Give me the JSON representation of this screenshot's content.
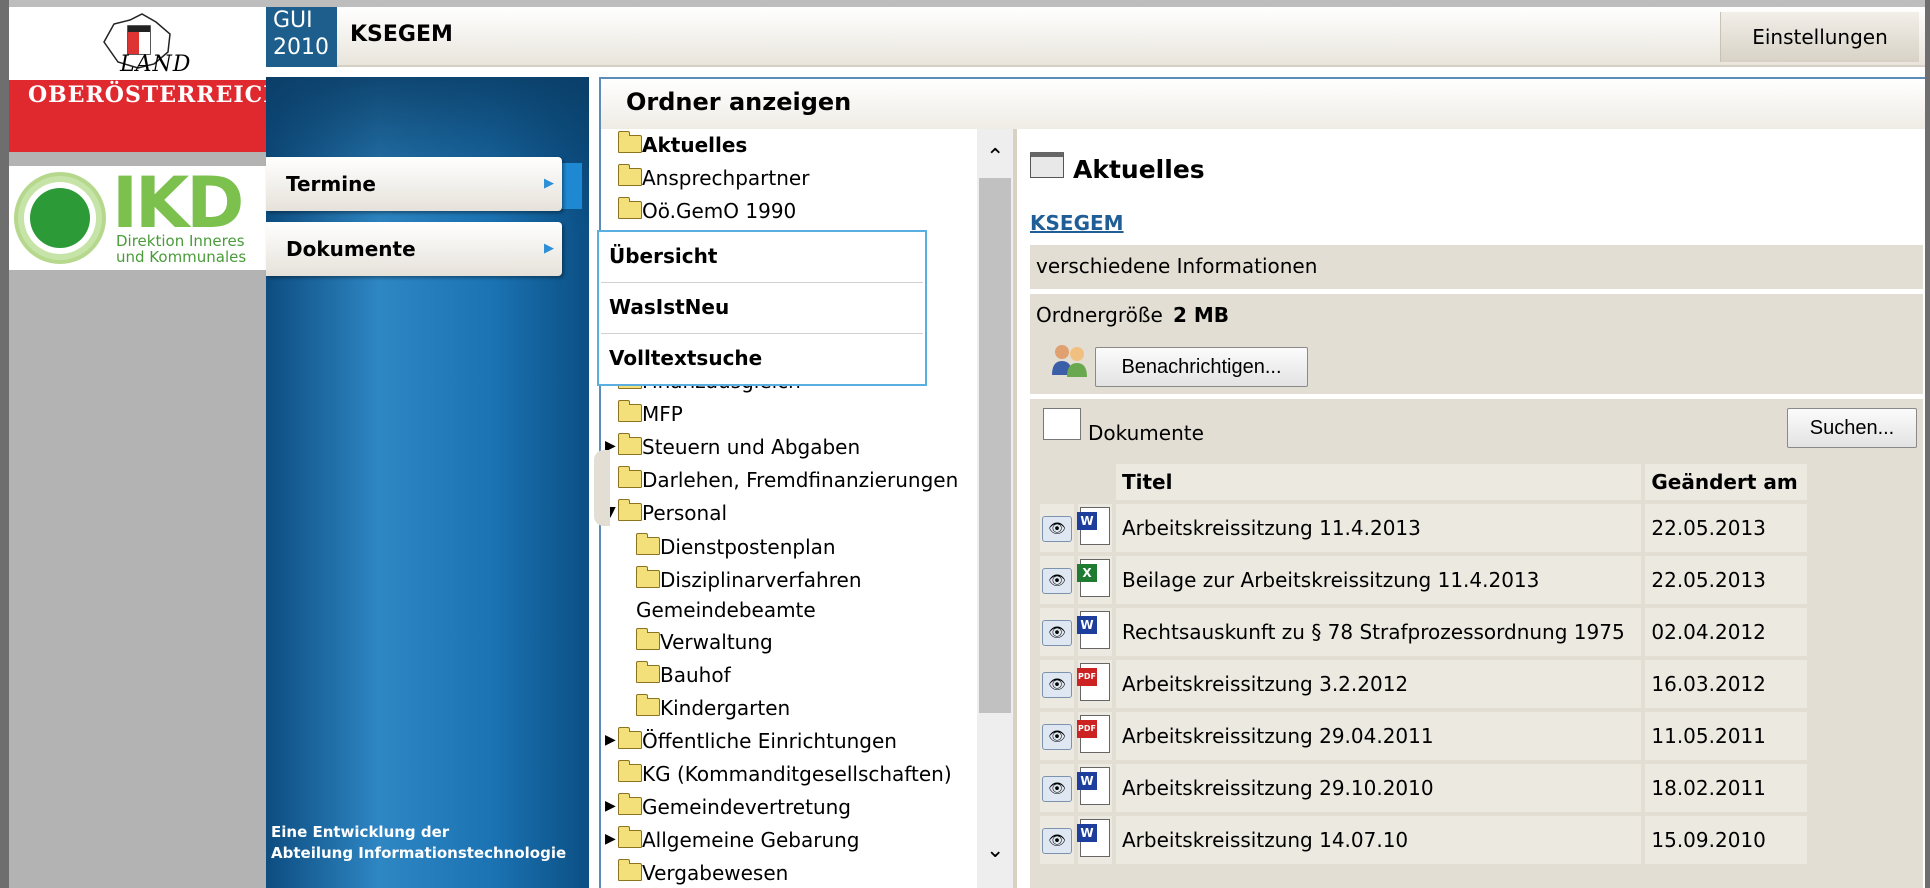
{
  "branding": {
    "land_label": "LAND",
    "state_label": "OBERÖSTERREICH",
    "ikd_label": "IKD",
    "ikd_subtitle_line1": "Direktion Inneres",
    "ikd_subtitle_line2": "und Kommunales",
    "gui_line1": "GUI",
    "gui_line2": "2010"
  },
  "header": {
    "app_title": "KSEGEM",
    "settings_label": "Einstellungen"
  },
  "nav": {
    "items": [
      {
        "label": "Termine"
      },
      {
        "label": "Dokumente"
      }
    ],
    "footer_line1": "Eine Entwicklung der",
    "footer_line2": "Abteilung Informationstechnologie"
  },
  "dropdown": {
    "items": [
      {
        "label": "Übersicht"
      },
      {
        "label": "WasIstNeu"
      },
      {
        "label": "Volltextsuche"
      }
    ]
  },
  "folders": {
    "title": "Ordner anzeigen",
    "items": [
      {
        "label": "Aktuelles",
        "bold": true
      },
      {
        "label": "Ansprechpartner"
      },
      {
        "label": "Oö.GemO 1990"
      },
      {
        "label": "Finanzausgleich"
      },
      {
        "label": "MFP"
      },
      {
        "label": "Steuern und Abgaben",
        "expandable": true
      },
      {
        "label": "Darlehen, Fremdfinanzierungen"
      },
      {
        "label": "Personal",
        "expandable": true
      },
      {
        "label": "Dienstpostenplan"
      },
      {
        "label": "Disziplinarverfahren"
      },
      {
        "label": "Gemeindebeamte"
      },
      {
        "label": "Verwaltung"
      },
      {
        "label": "Bauhof"
      },
      {
        "label": "Kindergarten"
      },
      {
        "label": "Öffentliche Einrichtungen",
        "expandable": true
      },
      {
        "label": "KG (Kommanditgesellschaften)"
      },
      {
        "label": "Gemeindevertretung",
        "expandable": true
      },
      {
        "label": "Allgemeine Gebarung",
        "expandable": true
      },
      {
        "label": "Vergabewesen"
      }
    ]
  },
  "content": {
    "title": "Aktuelles",
    "link": "KSEGEM",
    "description": "verschiedene Informationen",
    "size_label": "Ordnergröße",
    "size_value": "2 MB",
    "notify_label": "Benachrichtigen...",
    "docs_label": "Dokumente",
    "search_label": "Suchen...",
    "table": {
      "headers": [
        "Titel",
        "Geändert am"
      ],
      "rows": [
        {
          "type": "word",
          "title": "Arbeitskreissitzung 11.4.2013",
          "date": "22.05.2013"
        },
        {
          "type": "excel",
          "title": "Beilage zur Arbeitskreissitzung 11.4.2013",
          "date": "22.05.2013"
        },
        {
          "type": "word",
          "title": "Rechtsauskunft zu § 78 Strafprozessordnung 1975",
          "date": "02.04.2012"
        },
        {
          "type": "pdf",
          "title": "Arbeitskreissitzung 3.2.2012",
          "date": "16.03.2012"
        },
        {
          "type": "pdf",
          "title": "Arbeitskreissitzung 29.04.2011",
          "date": "11.05.2011"
        },
        {
          "type": "word",
          "title": "Arbeitskreissitzung 29.10.2010",
          "date": "18.02.2011"
        },
        {
          "type": "word",
          "title": "Arbeitskreissitzung 14.07.10",
          "date": "15.09.2010"
        }
      ]
    }
  },
  "colors": {
    "brand_red": "#e0282f",
    "nav_blue": "#1b73b3",
    "ikd_green": "#7cc04e",
    "link_blue": "#1f5e97"
  }
}
